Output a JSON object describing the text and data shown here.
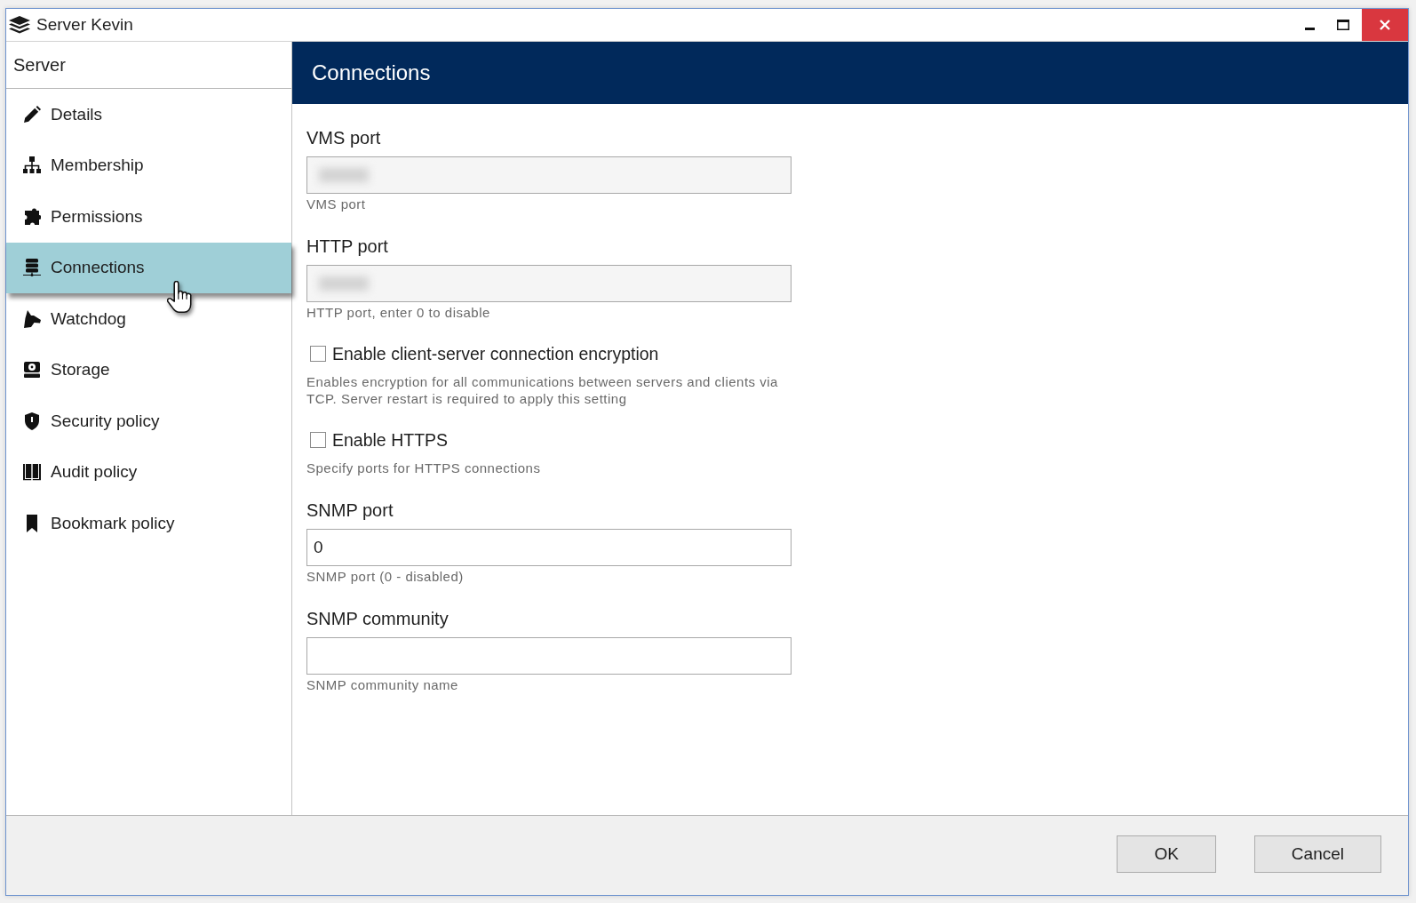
{
  "window": {
    "title": "Server Kevin"
  },
  "sidebar": {
    "header": "Server",
    "items": [
      {
        "label": "Details",
        "selected": false
      },
      {
        "label": "Membership",
        "selected": false
      },
      {
        "label": "Permissions",
        "selected": false
      },
      {
        "label": "Connections",
        "selected": true
      },
      {
        "label": "Watchdog",
        "selected": false
      },
      {
        "label": "Storage",
        "selected": false
      },
      {
        "label": "Security policy",
        "selected": false
      },
      {
        "label": "Audit policy",
        "selected": false
      },
      {
        "label": "Bookmark policy",
        "selected": false
      }
    ]
  },
  "panel": {
    "title": "Connections",
    "fields": [
      {
        "kind": "input",
        "label": "VMS port",
        "redacted": true,
        "hint": "VMS port"
      },
      {
        "kind": "input",
        "label": "HTTP port",
        "redacted": true,
        "hint": "HTTP port, enter 0 to disable"
      },
      {
        "kind": "checkbox",
        "label": "Enable client-server connection encryption",
        "checked": false,
        "hint": "Enables encryption for all communications between servers and clients via TCP. Server restart is required to apply this setting"
      },
      {
        "kind": "checkbox",
        "label": "Enable HTTPS",
        "checked": false,
        "hint": "Specify ports for HTTPS connections"
      },
      {
        "kind": "input",
        "label": "SNMP port",
        "value": "0",
        "redacted": false,
        "hint": "SNMP port (0 - disabled)"
      },
      {
        "kind": "input",
        "label": "SNMP community",
        "redacted": false,
        "hint": "SNMP community name"
      }
    ]
  },
  "buttons": [
    "OK",
    "Cancel"
  ]
}
